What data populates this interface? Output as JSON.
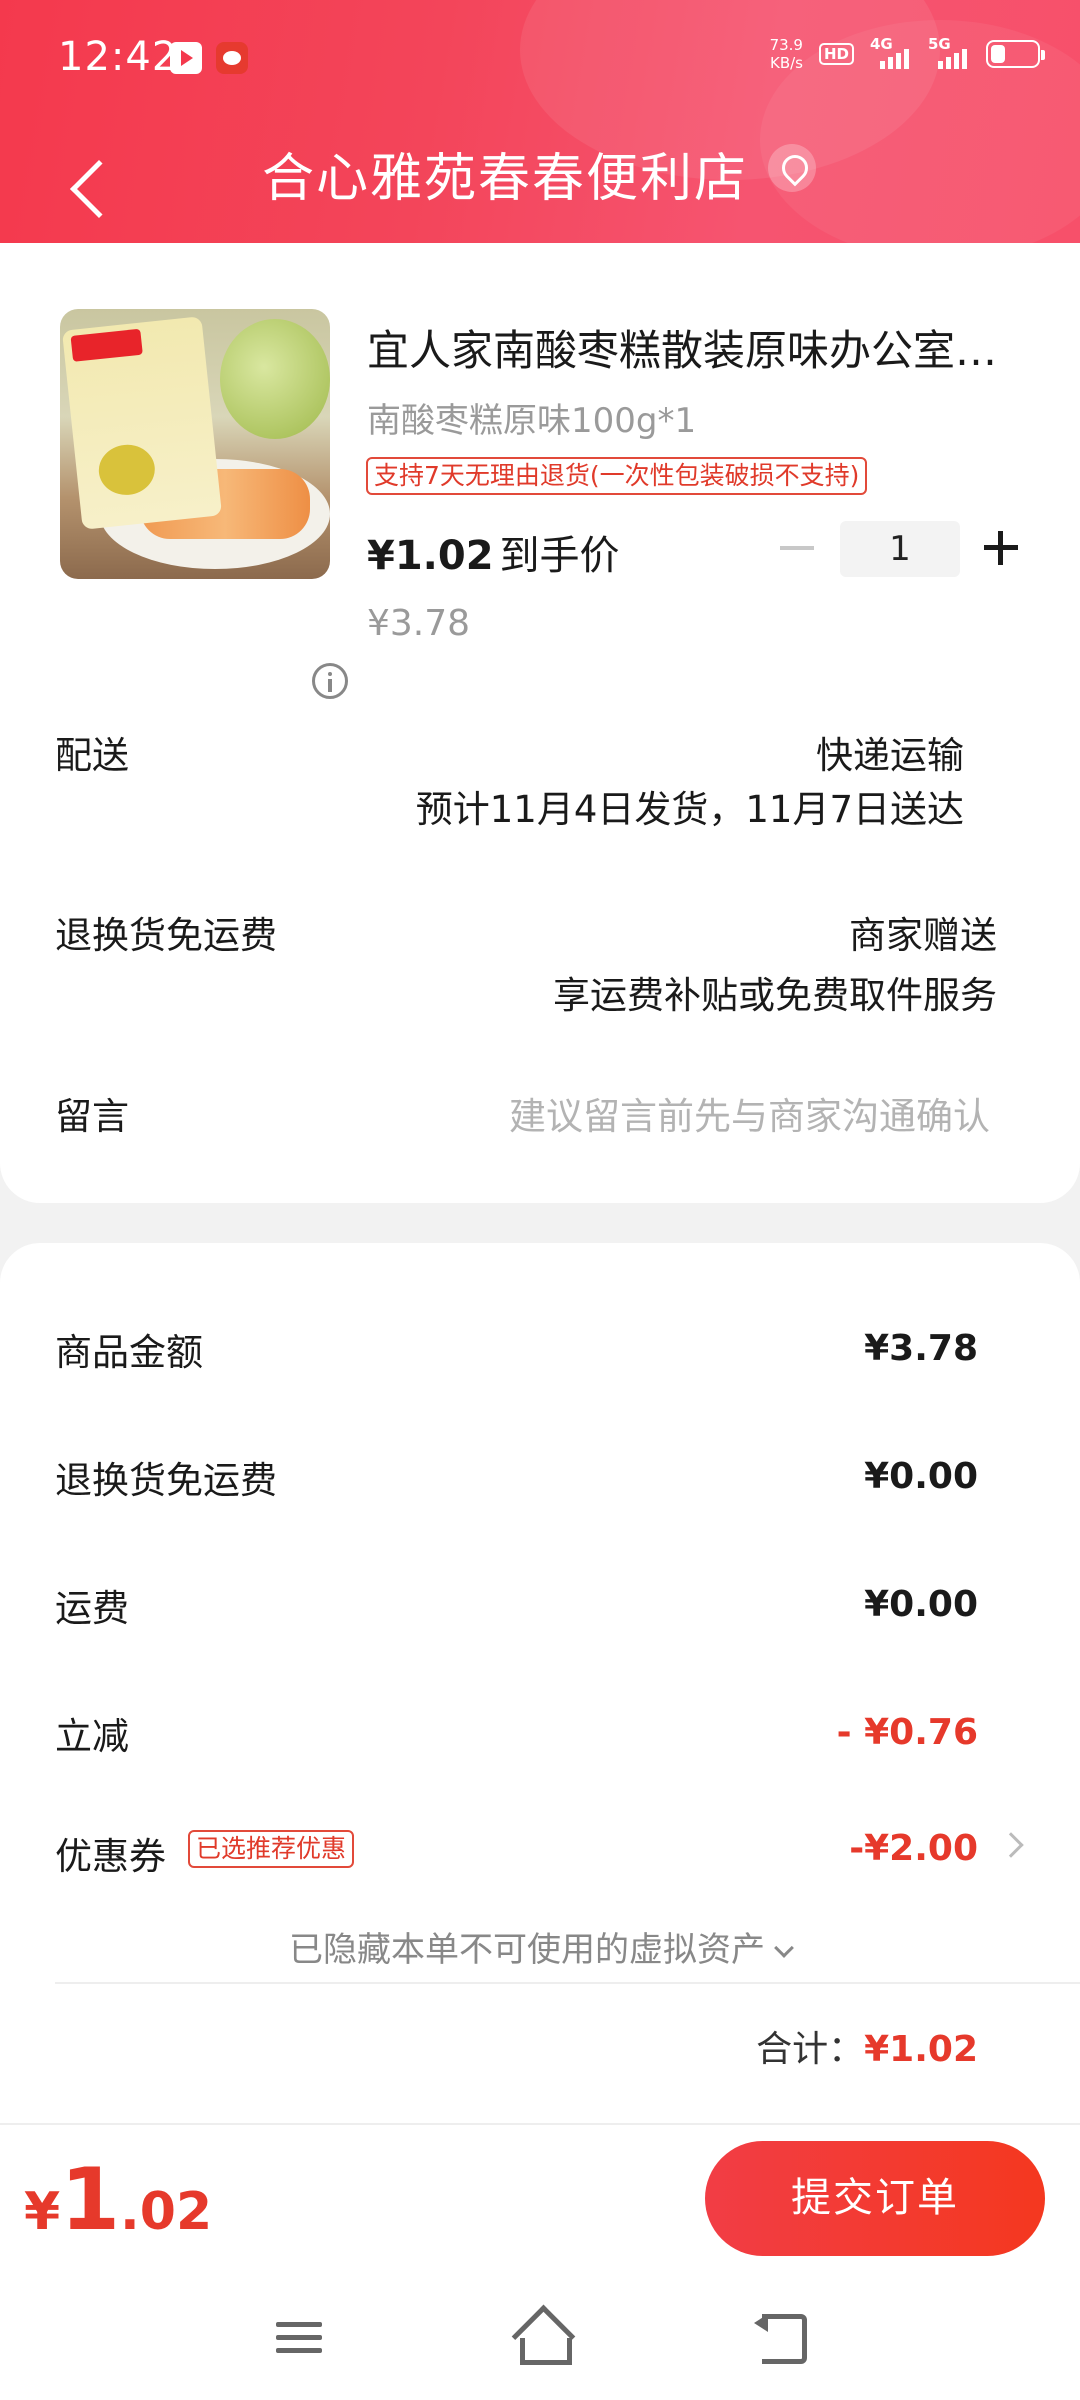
{
  "status_bar": {
    "time": "12:42",
    "net_speed_value": "73.9",
    "net_speed_unit": "KB/s",
    "hd_label": "HD",
    "sig1_label": "4G",
    "sig2_label": "5G"
  },
  "header": {
    "title": "合心雅苑春春便利店"
  },
  "product": {
    "title": "宜人家南酸枣糕散装原味办公室休闲零食小吃",
    "spec": "南酸枣糕原味100g*1",
    "return_tag": "支持7天无理由退货(一次性包装破损不支持)",
    "final_price": "¥1.02",
    "final_price_suffix": "到手价",
    "original_price": "¥3.78",
    "quantity": "1"
  },
  "delivery": {
    "label": "配送",
    "method": "快递运输",
    "estimate": "预计11月4日发货，11月7日送达"
  },
  "return_shipping": {
    "label": "退换货免运费",
    "value": "商家赠送",
    "desc": "享运费补贴或免费取件服务"
  },
  "note": {
    "label": "留言",
    "placeholder": "建议留言前先与商家沟通确认"
  },
  "amounts": {
    "goods_label": "商品金额",
    "goods_value": "¥3.78",
    "return_fee_label": "退换货免运费",
    "return_fee_value": "¥0.00",
    "shipping_label": "运费",
    "shipping_value": "¥0.00",
    "instant_discount_label": "立减",
    "instant_discount_value": "- ¥0.76",
    "coupon_label": "优惠券",
    "coupon_badge": "已选推荐优惠",
    "coupon_value": "-¥2.00",
    "hidden_assets_text": "已隐藏本单不可使用的虚拟资产",
    "total_label": "合计：",
    "total_value": "¥1.02"
  },
  "bottom": {
    "currency": "¥",
    "price_int": "1",
    "price_dec": ".02",
    "submit_label": "提交订单"
  },
  "colors": {
    "brand_red": "#f4394d",
    "price_red": "#e6392b"
  }
}
